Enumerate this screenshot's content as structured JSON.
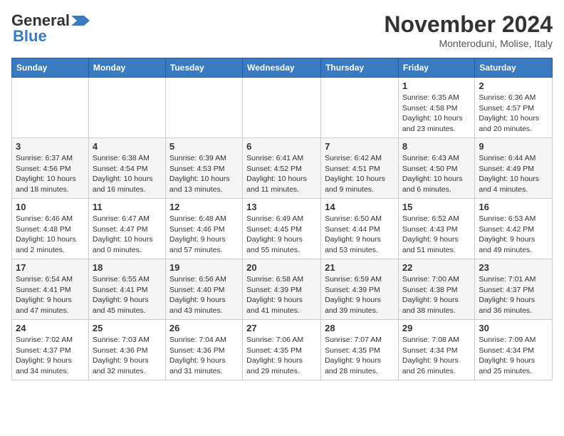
{
  "header": {
    "logo_general": "General",
    "logo_blue": "Blue",
    "title": "November 2024",
    "subtitle": "Monteroduni, Molise, Italy"
  },
  "days_of_week": [
    "Sunday",
    "Monday",
    "Tuesday",
    "Wednesday",
    "Thursday",
    "Friday",
    "Saturday"
  ],
  "weeks": [
    {
      "days": [
        {
          "num": "",
          "info": ""
        },
        {
          "num": "",
          "info": ""
        },
        {
          "num": "",
          "info": ""
        },
        {
          "num": "",
          "info": ""
        },
        {
          "num": "",
          "info": ""
        },
        {
          "num": "1",
          "info": "Sunrise: 6:35 AM\nSunset: 4:58 PM\nDaylight: 10 hours\nand 23 minutes."
        },
        {
          "num": "2",
          "info": "Sunrise: 6:36 AM\nSunset: 4:57 PM\nDaylight: 10 hours\nand 20 minutes."
        }
      ]
    },
    {
      "days": [
        {
          "num": "3",
          "info": "Sunrise: 6:37 AM\nSunset: 4:56 PM\nDaylight: 10 hours\nand 18 minutes."
        },
        {
          "num": "4",
          "info": "Sunrise: 6:38 AM\nSunset: 4:54 PM\nDaylight: 10 hours\nand 16 minutes."
        },
        {
          "num": "5",
          "info": "Sunrise: 6:39 AM\nSunset: 4:53 PM\nDaylight: 10 hours\nand 13 minutes."
        },
        {
          "num": "6",
          "info": "Sunrise: 6:41 AM\nSunset: 4:52 PM\nDaylight: 10 hours\nand 11 minutes."
        },
        {
          "num": "7",
          "info": "Sunrise: 6:42 AM\nSunset: 4:51 PM\nDaylight: 10 hours\nand 9 minutes."
        },
        {
          "num": "8",
          "info": "Sunrise: 6:43 AM\nSunset: 4:50 PM\nDaylight: 10 hours\nand 6 minutes."
        },
        {
          "num": "9",
          "info": "Sunrise: 6:44 AM\nSunset: 4:49 PM\nDaylight: 10 hours\nand 4 minutes."
        }
      ]
    },
    {
      "days": [
        {
          "num": "10",
          "info": "Sunrise: 6:46 AM\nSunset: 4:48 PM\nDaylight: 10 hours\nand 2 minutes."
        },
        {
          "num": "11",
          "info": "Sunrise: 6:47 AM\nSunset: 4:47 PM\nDaylight: 10 hours\nand 0 minutes."
        },
        {
          "num": "12",
          "info": "Sunrise: 6:48 AM\nSunset: 4:46 PM\nDaylight: 9 hours\nand 57 minutes."
        },
        {
          "num": "13",
          "info": "Sunrise: 6:49 AM\nSunset: 4:45 PM\nDaylight: 9 hours\nand 55 minutes."
        },
        {
          "num": "14",
          "info": "Sunrise: 6:50 AM\nSunset: 4:44 PM\nDaylight: 9 hours\nand 53 minutes."
        },
        {
          "num": "15",
          "info": "Sunrise: 6:52 AM\nSunset: 4:43 PM\nDaylight: 9 hours\nand 51 minutes."
        },
        {
          "num": "16",
          "info": "Sunrise: 6:53 AM\nSunset: 4:42 PM\nDaylight: 9 hours\nand 49 minutes."
        }
      ]
    },
    {
      "days": [
        {
          "num": "17",
          "info": "Sunrise: 6:54 AM\nSunset: 4:41 PM\nDaylight: 9 hours\nand 47 minutes."
        },
        {
          "num": "18",
          "info": "Sunrise: 6:55 AM\nSunset: 4:41 PM\nDaylight: 9 hours\nand 45 minutes."
        },
        {
          "num": "19",
          "info": "Sunrise: 6:56 AM\nSunset: 4:40 PM\nDaylight: 9 hours\nand 43 minutes."
        },
        {
          "num": "20",
          "info": "Sunrise: 6:58 AM\nSunset: 4:39 PM\nDaylight: 9 hours\nand 41 minutes."
        },
        {
          "num": "21",
          "info": "Sunrise: 6:59 AM\nSunset: 4:39 PM\nDaylight: 9 hours\nand 39 minutes."
        },
        {
          "num": "22",
          "info": "Sunrise: 7:00 AM\nSunset: 4:38 PM\nDaylight: 9 hours\nand 38 minutes."
        },
        {
          "num": "23",
          "info": "Sunrise: 7:01 AM\nSunset: 4:37 PM\nDaylight: 9 hours\nand 36 minutes."
        }
      ]
    },
    {
      "days": [
        {
          "num": "24",
          "info": "Sunrise: 7:02 AM\nSunset: 4:37 PM\nDaylight: 9 hours\nand 34 minutes."
        },
        {
          "num": "25",
          "info": "Sunrise: 7:03 AM\nSunset: 4:36 PM\nDaylight: 9 hours\nand 32 minutes."
        },
        {
          "num": "26",
          "info": "Sunrise: 7:04 AM\nSunset: 4:36 PM\nDaylight: 9 hours\nand 31 minutes."
        },
        {
          "num": "27",
          "info": "Sunrise: 7:06 AM\nSunset: 4:35 PM\nDaylight: 9 hours\nand 29 minutes."
        },
        {
          "num": "28",
          "info": "Sunrise: 7:07 AM\nSunset: 4:35 PM\nDaylight: 9 hours\nand 28 minutes."
        },
        {
          "num": "29",
          "info": "Sunrise: 7:08 AM\nSunset: 4:34 PM\nDaylight: 9 hours\nand 26 minutes."
        },
        {
          "num": "30",
          "info": "Sunrise: 7:09 AM\nSunset: 4:34 PM\nDaylight: 9 hours\nand 25 minutes."
        }
      ]
    }
  ]
}
